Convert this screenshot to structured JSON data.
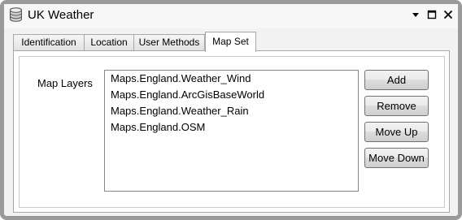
{
  "window": {
    "title": "UK Weather",
    "icon": "database-icon",
    "controls": [
      "menu-dropdown-icon",
      "maximize-icon",
      "close-icon"
    ]
  },
  "tabs": [
    {
      "label": "Identification",
      "active": false
    },
    {
      "label": "Location",
      "active": false
    },
    {
      "label": "User Methods",
      "active": false
    },
    {
      "label": "Map Set",
      "active": true
    }
  ],
  "map_set": {
    "layers_label": "Map Layers",
    "layers": [
      "Maps.England.Weather_Wind",
      "Maps.England.ArcGisBaseWorld",
      "Maps.England.Weather_Rain",
      "Maps.England.OSM"
    ],
    "buttons": {
      "add": "Add",
      "remove": "Remove",
      "move_up": "Move Up",
      "move_down": "Move Down"
    }
  },
  "colors": {
    "window_border": "#9a9a9a",
    "panel_border": "#a7a7a7",
    "background": "#f2f2f2"
  }
}
